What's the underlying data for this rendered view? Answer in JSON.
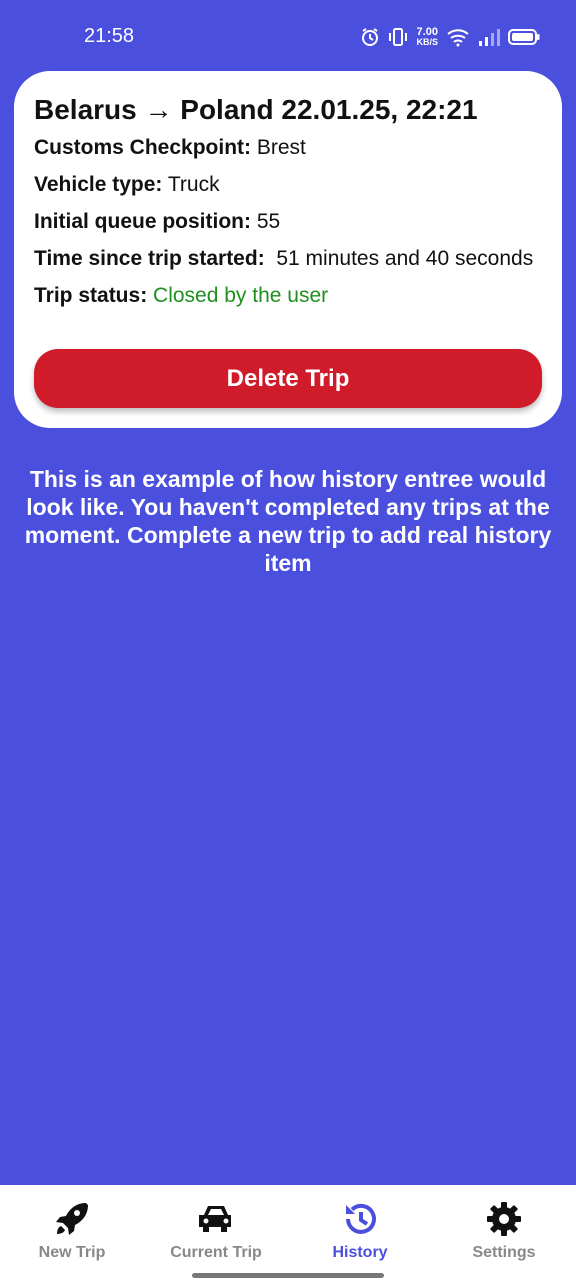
{
  "status_bar": {
    "time": "21:58",
    "net_speed_value": "7.00",
    "net_speed_unit": "KB/S"
  },
  "trip_card": {
    "title": "Belarus → Poland 22.01.25, 22:21",
    "checkpoint_label": "Customs Checkpoint:",
    "checkpoint_value": "Brest",
    "vehicle_label": "Vehicle type:",
    "vehicle_value": "Truck",
    "queue_label": "Initial queue position:",
    "queue_value": "55",
    "time_label": "Time since trip started:",
    "time_value": "51 minutes and 40 seconds",
    "status_label": "Trip status:",
    "status_value": "Closed by the user",
    "delete_label": "Delete Trip"
  },
  "info_text": "This is an example of how history entree would look like. You haven't completed any trips at the moment. Complete a new trip to add real history item",
  "nav": {
    "items": [
      {
        "label": "New Trip",
        "icon": "rocket-icon"
      },
      {
        "label": "Current Trip",
        "icon": "car-icon"
      },
      {
        "label": "History",
        "icon": "history-icon",
        "active": true
      },
      {
        "label": "Settings",
        "icon": "gear-icon"
      }
    ]
  },
  "colors": {
    "background": "#4b4fde",
    "delete": "#d01b2a",
    "status_green": "#1f8f1f"
  }
}
